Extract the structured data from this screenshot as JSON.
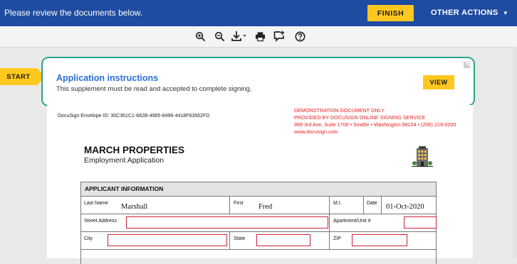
{
  "topbar": {
    "message": "Please review the documents below.",
    "finish_label": "FINISH",
    "other_actions_label": "OTHER ACTIONS"
  },
  "toolbar": {
    "icons": [
      "zoom-in-icon",
      "zoom-out-icon",
      "download-icon",
      "print-icon",
      "comment-icon",
      "help-icon"
    ]
  },
  "start_label": "START",
  "supplement": {
    "title": "Application instructions",
    "description": "This supplement must be read and accepted to complete signing.",
    "view_label": "VIEW"
  },
  "document": {
    "envelope_id": "DocuSign Envelope ID: 30C361C1-682B-4965-8496-4418F63562FD",
    "demo_lines": [
      "DEMONSTRATION DOCUMENT ONLY",
      "PROVIDED BY DOCUSIGN ONLINE SIGNING SERVICE",
      "999 3rd Ave, Suite 1700  •  Seattle • Washington 98104 • (206) 219-0200",
      "www.docusign.com"
    ],
    "company": "MARCH PROPERTIES",
    "app_type": "Employment Application",
    "section_title": "APPLICANT INFORMATION",
    "labels": {
      "last_name": "Last Name",
      "first": "First",
      "mi": "M.I.",
      "date": "Date",
      "street": "Street Address",
      "apartment": "Apartment/Unit #",
      "city": "City",
      "state": "State",
      "zip": "ZIP"
    },
    "values": {
      "last_name": "Marshall",
      "first": "Fred",
      "date": "01-Oct-2020"
    }
  },
  "colors": {
    "topbar": "#1f4ba0",
    "accent": "#ffc820",
    "supplement_border": "#2aa58b",
    "link_blue": "#2b6fd6",
    "demo_red": "#e0221f",
    "field_border": "#c8233a"
  }
}
